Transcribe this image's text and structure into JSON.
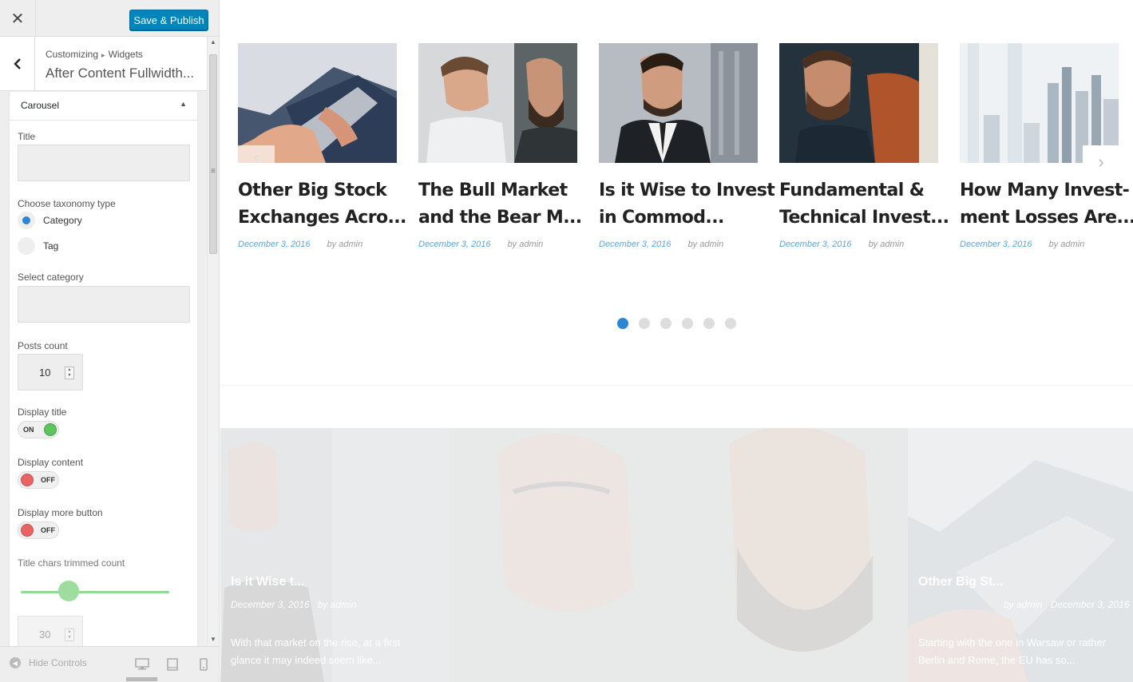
{
  "header": {
    "close_label": "✕",
    "publish_label": "Save & Publish"
  },
  "panel": {
    "breadcrumb_root": "Customizing",
    "breadcrumb_sep": "▸",
    "breadcrumb_leaf": "Widgets",
    "title": "After Content Fullwidth..."
  },
  "widget": {
    "name": "Carousel",
    "title_label": "Title",
    "title_value": "",
    "taxonomy_label": "Choose taxonomy type",
    "taxonomy_options": [
      "Category",
      "Tag"
    ],
    "taxonomy_selected": "Category",
    "category_label": "Select category",
    "category_value": "",
    "posts_count_label": "Posts count",
    "posts_count_value": "10",
    "display_title_label": "Display title",
    "display_title_state": "ON",
    "display_content_label": "Display content",
    "display_content_state": "OFF",
    "display_more_label": "Display more button",
    "display_more_state": "OFF",
    "trim_label": "Title chars trimmed count",
    "trim_value": "30",
    "trim_fraction": 0.32
  },
  "footer": {
    "hide_controls": "Hide Controls"
  },
  "colors": {
    "accent": "#0085ba",
    "link_blue": "#5aa7d9",
    "toggle_on": "#5ec55e",
    "toggle_off": "#e86464",
    "dot_active": "#2b87d3"
  },
  "carousel": {
    "posts": [
      {
        "title_l1": "Other Big Stock",
        "title_l2": "Exchanges Acro...",
        "date": "December 3, 2016",
        "author": "by admin"
      },
      {
        "title_l1": "The Bull Market",
        "title_l2": "and the Bear M...",
        "date": "December 3, 2016",
        "author": "by admin"
      },
      {
        "title_l1": "Is it Wise to Invest",
        "title_l2": "in Commod...",
        "date": "December 3, 2016",
        "author": "by admin"
      },
      {
        "title_l1": "Fundamental &",
        "title_l2": "Technical Invest...",
        "date": "December 3, 2016",
        "author": "by admin"
      },
      {
        "title_l1": "How Many Invest-",
        "title_l2": "ment Losses Are...",
        "date": "December 3, 2016",
        "author": "by admin"
      }
    ],
    "prev_icon": "‹",
    "next_icon": "›",
    "page_count": 6,
    "active_page": 1
  },
  "feature": {
    "left": {
      "title": "Is it Wise t...",
      "date": "December 3, 2016",
      "author": "by admin",
      "excerpt_l1": "With that market on the rise, at a first",
      "excerpt_l2": "glance it may indeed seem like..."
    },
    "right": {
      "title": "Other Big St...",
      "date": "December 3, 2016",
      "author": "by admin",
      "excerpt_l1": "Starting with the one in Warsaw or rather",
      "excerpt_l2": "Berlin and Rome, the EU has so..."
    }
  }
}
